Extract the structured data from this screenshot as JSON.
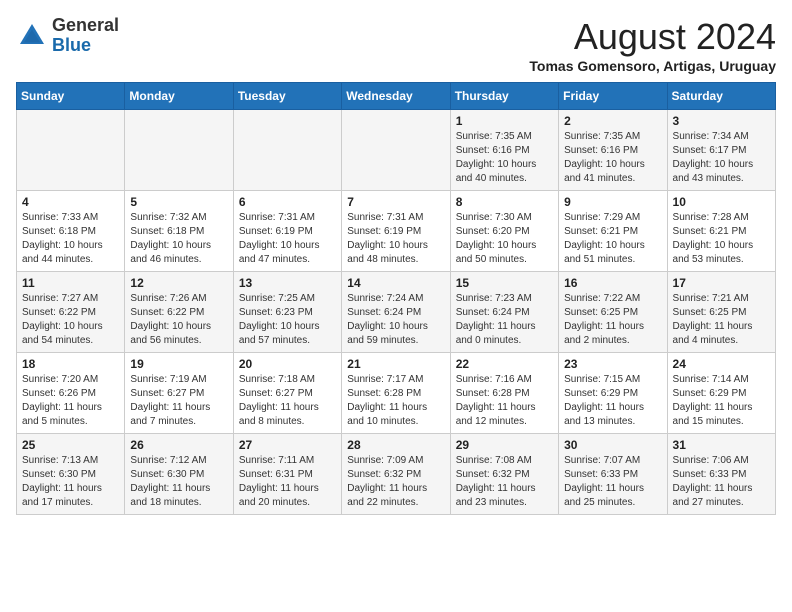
{
  "header": {
    "logo_general": "General",
    "logo_blue": "Blue",
    "month_year": "August 2024",
    "location": "Tomas Gomensoro, Artigas, Uruguay"
  },
  "days_of_week": [
    "Sunday",
    "Monday",
    "Tuesday",
    "Wednesday",
    "Thursday",
    "Friday",
    "Saturday"
  ],
  "weeks": [
    [
      {
        "day": "",
        "info": ""
      },
      {
        "day": "",
        "info": ""
      },
      {
        "day": "",
        "info": ""
      },
      {
        "day": "",
        "info": ""
      },
      {
        "day": "1",
        "info": "Sunrise: 7:35 AM\nSunset: 6:16 PM\nDaylight: 10 hours\nand 40 minutes."
      },
      {
        "day": "2",
        "info": "Sunrise: 7:35 AM\nSunset: 6:16 PM\nDaylight: 10 hours\nand 41 minutes."
      },
      {
        "day": "3",
        "info": "Sunrise: 7:34 AM\nSunset: 6:17 PM\nDaylight: 10 hours\nand 43 minutes."
      }
    ],
    [
      {
        "day": "4",
        "info": "Sunrise: 7:33 AM\nSunset: 6:18 PM\nDaylight: 10 hours\nand 44 minutes."
      },
      {
        "day": "5",
        "info": "Sunrise: 7:32 AM\nSunset: 6:18 PM\nDaylight: 10 hours\nand 46 minutes."
      },
      {
        "day": "6",
        "info": "Sunrise: 7:31 AM\nSunset: 6:19 PM\nDaylight: 10 hours\nand 47 minutes."
      },
      {
        "day": "7",
        "info": "Sunrise: 7:31 AM\nSunset: 6:19 PM\nDaylight: 10 hours\nand 48 minutes."
      },
      {
        "day": "8",
        "info": "Sunrise: 7:30 AM\nSunset: 6:20 PM\nDaylight: 10 hours\nand 50 minutes."
      },
      {
        "day": "9",
        "info": "Sunrise: 7:29 AM\nSunset: 6:21 PM\nDaylight: 10 hours\nand 51 minutes."
      },
      {
        "day": "10",
        "info": "Sunrise: 7:28 AM\nSunset: 6:21 PM\nDaylight: 10 hours\nand 53 minutes."
      }
    ],
    [
      {
        "day": "11",
        "info": "Sunrise: 7:27 AM\nSunset: 6:22 PM\nDaylight: 10 hours\nand 54 minutes."
      },
      {
        "day": "12",
        "info": "Sunrise: 7:26 AM\nSunset: 6:22 PM\nDaylight: 10 hours\nand 56 minutes."
      },
      {
        "day": "13",
        "info": "Sunrise: 7:25 AM\nSunset: 6:23 PM\nDaylight: 10 hours\nand 57 minutes."
      },
      {
        "day": "14",
        "info": "Sunrise: 7:24 AM\nSunset: 6:24 PM\nDaylight: 10 hours\nand 59 minutes."
      },
      {
        "day": "15",
        "info": "Sunrise: 7:23 AM\nSunset: 6:24 PM\nDaylight: 11 hours\nand 0 minutes."
      },
      {
        "day": "16",
        "info": "Sunrise: 7:22 AM\nSunset: 6:25 PM\nDaylight: 11 hours\nand 2 minutes."
      },
      {
        "day": "17",
        "info": "Sunrise: 7:21 AM\nSunset: 6:25 PM\nDaylight: 11 hours\nand 4 minutes."
      }
    ],
    [
      {
        "day": "18",
        "info": "Sunrise: 7:20 AM\nSunset: 6:26 PM\nDaylight: 11 hours\nand 5 minutes."
      },
      {
        "day": "19",
        "info": "Sunrise: 7:19 AM\nSunset: 6:27 PM\nDaylight: 11 hours\nand 7 minutes."
      },
      {
        "day": "20",
        "info": "Sunrise: 7:18 AM\nSunset: 6:27 PM\nDaylight: 11 hours\nand 8 minutes."
      },
      {
        "day": "21",
        "info": "Sunrise: 7:17 AM\nSunset: 6:28 PM\nDaylight: 11 hours\nand 10 minutes."
      },
      {
        "day": "22",
        "info": "Sunrise: 7:16 AM\nSunset: 6:28 PM\nDaylight: 11 hours\nand 12 minutes."
      },
      {
        "day": "23",
        "info": "Sunrise: 7:15 AM\nSunset: 6:29 PM\nDaylight: 11 hours\nand 13 minutes."
      },
      {
        "day": "24",
        "info": "Sunrise: 7:14 AM\nSunset: 6:29 PM\nDaylight: 11 hours\nand 15 minutes."
      }
    ],
    [
      {
        "day": "25",
        "info": "Sunrise: 7:13 AM\nSunset: 6:30 PM\nDaylight: 11 hours\nand 17 minutes."
      },
      {
        "day": "26",
        "info": "Sunrise: 7:12 AM\nSunset: 6:30 PM\nDaylight: 11 hours\nand 18 minutes."
      },
      {
        "day": "27",
        "info": "Sunrise: 7:11 AM\nSunset: 6:31 PM\nDaylight: 11 hours\nand 20 minutes."
      },
      {
        "day": "28",
        "info": "Sunrise: 7:09 AM\nSunset: 6:32 PM\nDaylight: 11 hours\nand 22 minutes."
      },
      {
        "day": "29",
        "info": "Sunrise: 7:08 AM\nSunset: 6:32 PM\nDaylight: 11 hours\nand 23 minutes."
      },
      {
        "day": "30",
        "info": "Sunrise: 7:07 AM\nSunset: 6:33 PM\nDaylight: 11 hours\nand 25 minutes."
      },
      {
        "day": "31",
        "info": "Sunrise: 7:06 AM\nSunset: 6:33 PM\nDaylight: 11 hours\nand 27 minutes."
      }
    ]
  ]
}
